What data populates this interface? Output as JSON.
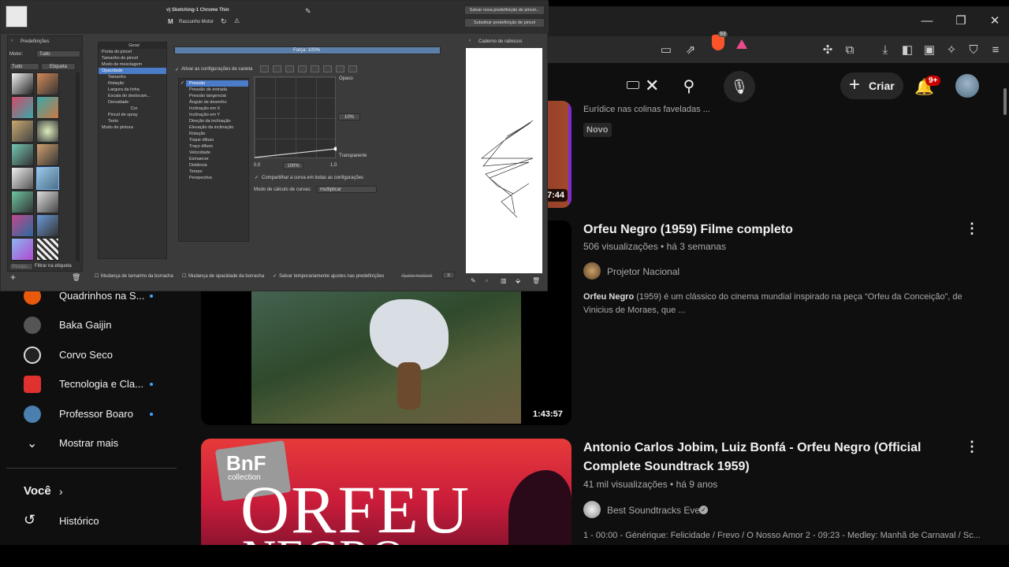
{
  "browser": {
    "window_controls": [
      "—",
      "❐",
      "✕"
    ],
    "brave_count": "93"
  },
  "yt_header": {
    "create_label": "Criar",
    "notif_count": "9+"
  },
  "feed": [
    {
      "title": "",
      "meta_partial": "Eurídice nas colinas faveladas ...",
      "badge": "Novo",
      "duration": "7:44"
    },
    {
      "title": "Orfeu Negro (1959) Filme completo",
      "meta": "506 visualizações • há 3 semanas",
      "channel": "Projetor Nacional",
      "desc_bold": "Orfeu Negro",
      "desc": " (1959) é um clássico do cinema mundial inspirado na peça “Orfeu da Conceição”, de Vinicius de Moraes, que ...",
      "duration": "1:43:57"
    },
    {
      "title": "Antonio Carlos Jobim, Luiz Bonfá - Orfeu Negro (Official Complete Soundtrack 1959)",
      "meta": "41 mil visualizações • há 9 anos",
      "channel": "Best Soundtracks Ever",
      "desc": "1 - 00:00 - Générique: Felicidade / Frevo / O Nosso Amor 2 - 09:23 - Medley: Manhã de Carnaval / Sc...",
      "thumb_text_1": "BnF",
      "thumb_text_2": "collection",
      "thumb_text_3": "ORFEU",
      "thumb_text_4": "NEGRO"
    }
  ],
  "sidebar": {
    "items": [
      {
        "label": "Quadrinhos na S...",
        "dot": true,
        "color": "#e8590c"
      },
      {
        "label": "Baka Gaijin",
        "dot": false,
        "color": "#555555"
      },
      {
        "label": "Corvo Seco",
        "dot": false,
        "color": "#dddddd"
      },
      {
        "label": "Tecnologia e Cla...",
        "dot": true,
        "color": "#e03131"
      },
      {
        "label": "Professor Boaro",
        "dot": true,
        "color": "#4a7fb0"
      }
    ],
    "show_more": "Mostrar mais",
    "you": "Você",
    "history": "Histórico"
  },
  "krita": {
    "preset_name": "v) Sketching-1 Chrome Thin",
    "engine": "Rascunho Motor",
    "save_new": "Salvar nova predefinição de pincel...",
    "overwrite": "Substituir predefinição de pincel",
    "presets_label": "Predefinições",
    "motor_label": "Motor:",
    "motor_value": "Tudo",
    "tag_value": "Tudo",
    "tag_btn": "Etiqueta",
    "filter_label": "Filtrar na etiqueta",
    "search_placeholder": "Pesqui...",
    "categories_header": "Geral",
    "categories": [
      "Ponta do pincel",
      "Tamanho do pincel",
      "Modo de mesclagem",
      "Opacidade",
      "Tamanho",
      "Rotação",
      "Largura da linha",
      "Escala do deslocam...",
      "Densidade"
    ],
    "color_header": "Cor",
    "color_items": [
      "Pincel de spray",
      "Texto",
      "Modo de pintura"
    ],
    "force_label": "Força: 100%",
    "enable_curve": "Ativar as configurações de caneta",
    "sensors": [
      "Pressão",
      "Pressão de entrada",
      "Pressão tangencial",
      "Ângulo de desenho",
      "Inclinação em X",
      "Inclinação em Y",
      "Direção da inclinação",
      "Elevação da inclinação",
      "Rotação",
      "Toque difuso",
      "Traço difuso",
      "Velocidade",
      "Esmaecer",
      "Distância",
      "Tempo",
      "Perspectiva"
    ],
    "opaque": "Opaco",
    "transparent": "Transparente",
    "pct_right": "10%",
    "pct_bottom": "100%",
    "axis_min": "0,0",
    "axis_max": "1,0",
    "share_curve": "Compartilhar a curva em todas as configurações",
    "curve_mode_label": "Modo de cálculo de curvas:",
    "curve_mode_value": "multiplicar",
    "scratchpad": "Caderno de rabiscos",
    "bottom_opts": [
      "Mudança de tamanho da borracha",
      "Mudança de opacidade da borracha",
      "Salvar temporariamente ajustes nas predefinições",
      "Ajuste mutável"
    ]
  }
}
